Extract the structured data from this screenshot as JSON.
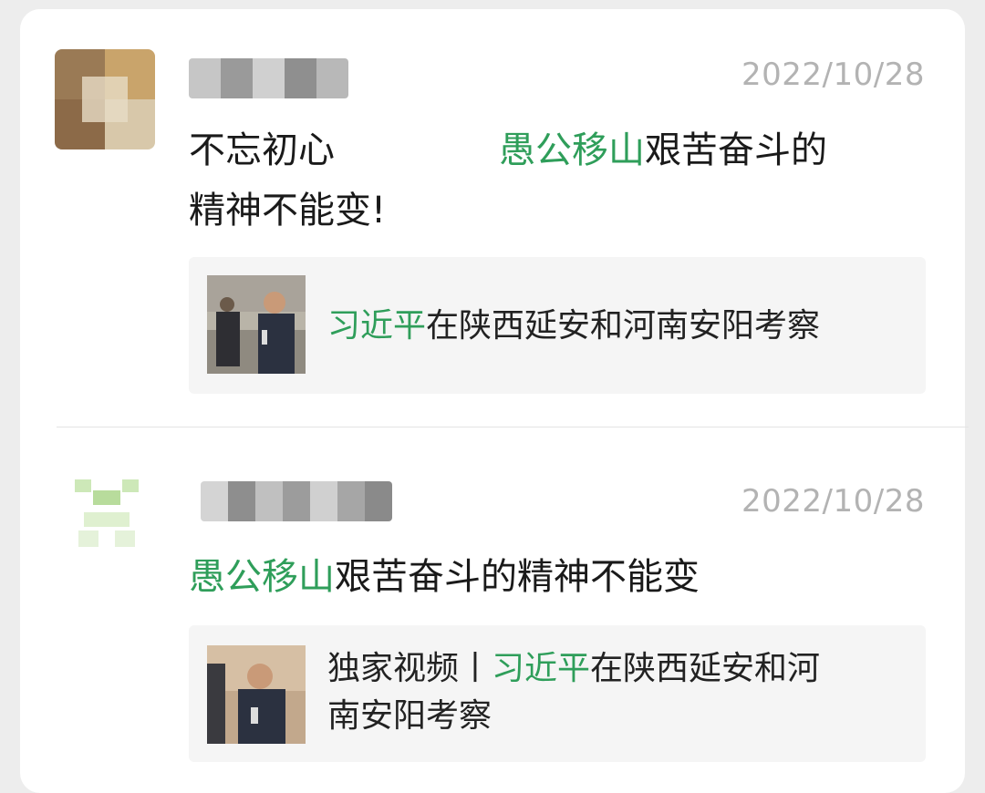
{
  "comments": [
    {
      "time": "2022/10/28",
      "text_part1": "不忘初心",
      "text_hl": "愚公移山",
      "text_part2": "艰苦奋斗的",
      "text_line2": "精神不能变!",
      "share": {
        "title_hl": "习近平",
        "title_rest": "在陕西延安和河南安阳考察"
      }
    },
    {
      "time": "2022/10/28",
      "text_hl": "愚公移山",
      "text_rest": "艰苦奋斗的精神不能变",
      "share": {
        "title_prefix": "独家视频丨",
        "title_hl": "习近平",
        "title_rest": "在陕西延安和河",
        "title_line2": "南安阳考察"
      }
    }
  ],
  "colors": {
    "highlight": "#2f9e5a",
    "timestamp": "#b3b3b3",
    "card_bg": "#ffffff",
    "page_bg": "#ededed",
    "share_bg": "#f5f5f5"
  }
}
